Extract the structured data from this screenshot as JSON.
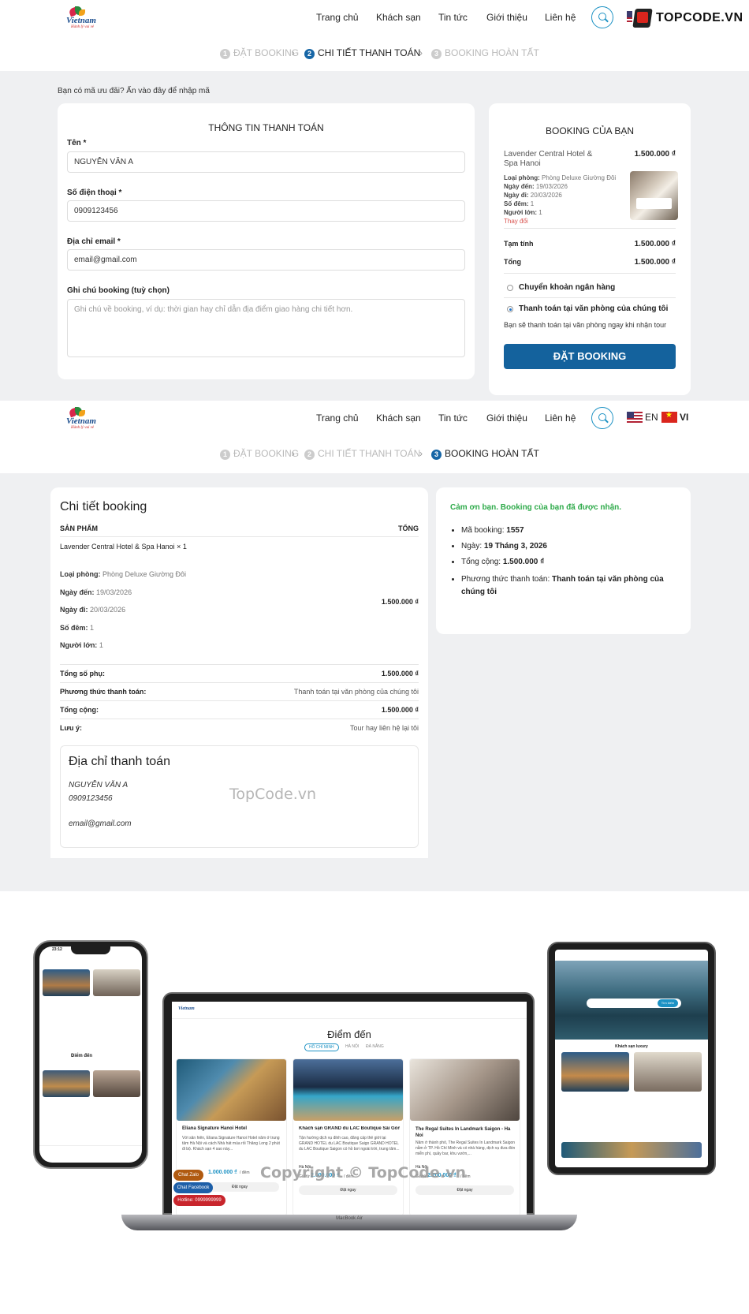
{
  "header": {
    "logo_text": "Vietnam",
    "logo_slogan": "Hành lý vui vẻ",
    "nav": [
      "Trang chủ",
      "Khách sạn",
      "Tin tức",
      "Giới thiệu",
      "Liên hệ"
    ],
    "lang_en": "EN",
    "lang_vi": "VI",
    "watermark_logo": "TOPCODE.VN"
  },
  "steps": [
    "ĐẶT BOOKING",
    "CHI TIẾT THANH TOÁN",
    "BOOKING HOÀN TẤT"
  ],
  "checkout": {
    "coupon": "Bạn có mã ưu đãi? Ấn vào đây để nhập mã",
    "title": "THÔNG TIN THANH TOÁN",
    "name_label": "Tên *",
    "name_value": "NGUYỄN VĂN A",
    "phone_label": "Số điện thoại *",
    "phone_value": "0909123456",
    "email_label": "Địa chỉ email *",
    "email_value": "email@gmail.com",
    "note_label": "Ghi chú booking (tuỳ chọn)",
    "note_placeholder": "Ghi chú về booking, ví dụ: thời gian hay chỉ dẫn địa điểm giao hàng chi tiết hơn."
  },
  "summary": {
    "title": "BOOKING CỦA BẠN",
    "hotel": "Lavender Central Hotel & Spa Hanoi",
    "price": "1.500.000 ₫",
    "room_type_label": "Loại phòng:",
    "room_type": "Phòng Deluxe Giường Đôi",
    "checkin_label": "Ngày đến:",
    "checkin": "19/03/2026",
    "checkout_label": "Ngày đi:",
    "checkout": "20/03/2026",
    "nights_label": "Số đêm:",
    "nights": "1",
    "adults_label": "Người lớn:",
    "adults": "1",
    "change": "Thay đổi",
    "subtotal_label": "Tạm tính",
    "subtotal": "1.500.000 ₫",
    "total_label": "Tổng",
    "total": "1.500.000 ₫",
    "pay_bank": "Chuyển khoản ngân hàng",
    "pay_office": "Thanh toán tại văn phòng của chúng tôi",
    "pay_note": "Bạn sẽ thanh toán tại văn phòng ngay khi nhận tour",
    "submit": "ĐẶT BOOKING"
  },
  "detail": {
    "title": "Chi tiết booking",
    "col_product": "SẢN PHẨM",
    "col_total": "TỔNG",
    "item": "Lavender Central Hotel & Spa Hanoi × 1",
    "room_type": "Phòng Deluxe Giường Đôi",
    "checkin": "19/03/2026",
    "checkout": "20/03/2026",
    "nights": "1",
    "adults": "1",
    "item_total": "1.500.000 ₫",
    "subtotal_label": "Tổng số phụ:",
    "subtotal": "1.500.000 ₫",
    "method_label": "Phương thức thanh toán:",
    "method": "Thanh toán tại văn phòng của chúng tôi",
    "total_label": "Tổng cộng:",
    "total": "1.500.000 ₫",
    "note_label": "Lưu ý:",
    "note": "Tour hay liên hệ lại tôi",
    "billing_title": "Địa chỉ thanh toán",
    "billing_name": "NGUYỄN VĂN A",
    "billing_phone": "0909123456",
    "billing_email": "email@gmail.com"
  },
  "thanks": {
    "message": "Cảm ơn bạn. Booking của bạn đã được nhận.",
    "code_label": "Mã booking:",
    "code": "1557",
    "date_label": "Ngày:",
    "date": "19 Tháng 3, 2026",
    "total_label": "Tổng cộng:",
    "total": "1.500.000 ₫",
    "method_label": "Phương thức thanh toán:",
    "method": "Thanh toán tại văn phòng của chúng tôi"
  },
  "mockup": {
    "section_title": "Điểm đến",
    "tabs": [
      "HỒ CHÍ MINH",
      "HÀ NỘI",
      "ĐÀ NẴNG"
    ],
    "cards": [
      {
        "name": "Eliana Signature Hanoi Hotel",
        "desc": "Với sân hiên, Eliana Signature Hanoi Hotel nằm ở trung tâm Hà Nội và cách Nhà hát múa rối Thăng Long 2 phút đi bộ. Khách sạn 4 sao này...",
        "city": "Quảng Bình",
        "price": "1.000.000 ₫",
        "unit": "/ đêm",
        "cta": "Đặt ngay"
      },
      {
        "name": "Khách sạn GRAND du LAC Boutique Sài Gòn",
        "desc": "Tận hưởng dịch vụ đỉnh cao, đẳng cấp thế giới tại GRAND HOTEL du LAC Boutique Saigo GRAND HOTEL du LAC Boutique Saigon có hồ bơi ngoài trời, trung tâm...",
        "city": "Hà Nội",
        "price": "2.000.000 ₫",
        "unit": "/ đêm",
        "cta": "Đặt ngay",
        "price_prefix": "Giá từ"
      },
      {
        "name": "The Regal Suites In Landmark Saigon - Ha Noi",
        "desc": "Nằm ở thành phố, The Regal Suites In Landmark Saigon nằm ở TP. Hồ Chí Minh và có nhà hàng, dịch vụ đưa đón miễn phí, quầy bar, khu vườn,...",
        "city": "Hà Nội",
        "price": "2.200.000 ₫",
        "unit": "/ đêm",
        "cta": "Đặt ngay",
        "price_prefix": "Giá từ"
      }
    ],
    "chat_zalo": "Chat Zalo",
    "chat_facebook": "Chat Facebook",
    "hotline": "Hotline: 0999999999",
    "laptop_label": "MacBook Air",
    "phone_time": "23:12",
    "tablet_label": "Khách sạn luxury",
    "tablet_search": "Tìm kiếm"
  },
  "watermarks": {
    "mid": "TopCode.vn",
    "footer": "Copyright © TopCode.vn"
  },
  "colors": {
    "primary": "#14629d",
    "success": "#2eaa4a",
    "danger": "#d9534f"
  }
}
